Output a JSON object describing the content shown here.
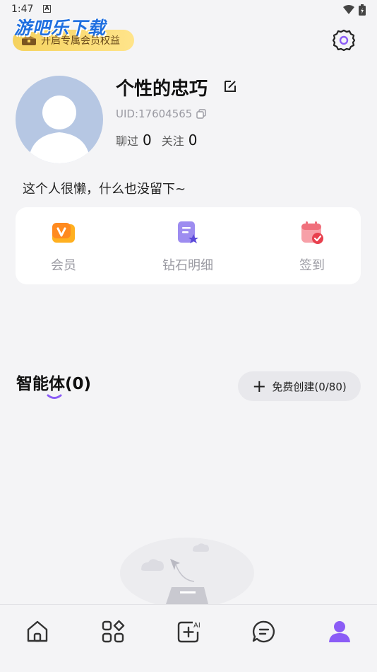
{
  "status_bar": {
    "time": "1:47"
  },
  "watermark": {
    "text": "游吧乐下载"
  },
  "vip_banner": {
    "label": "开启专属会员权益"
  },
  "profile": {
    "name": "个性的忠巧",
    "uid": "UID:17604565",
    "chatted_label": "聊过",
    "chatted_count": "0",
    "following_label": "关注",
    "following_count": "0",
    "bio": "这个人很懒，什么也没留下~"
  },
  "quick_actions": [
    {
      "label": "会员",
      "icon": "vip-icon"
    },
    {
      "label": "钻石明细",
      "icon": "diamond-detail-icon"
    },
    {
      "label": "签到",
      "icon": "calendar-check-icon"
    }
  ],
  "agents": {
    "title": "智能体(0)",
    "create_label": "免费创建(0/80)"
  },
  "bottom_nav": [
    {
      "name": "home",
      "icon": "home-icon"
    },
    {
      "name": "discover",
      "icon": "grid-icon"
    },
    {
      "name": "create-ai",
      "icon": "ai-add-icon"
    },
    {
      "name": "messages",
      "icon": "chat-icon"
    },
    {
      "name": "profile",
      "icon": "user-icon",
      "active": true
    }
  ],
  "colors": {
    "accent": "#8b5cf6",
    "background": "#f4f4f6",
    "vip_gold": "#f5d25e"
  }
}
